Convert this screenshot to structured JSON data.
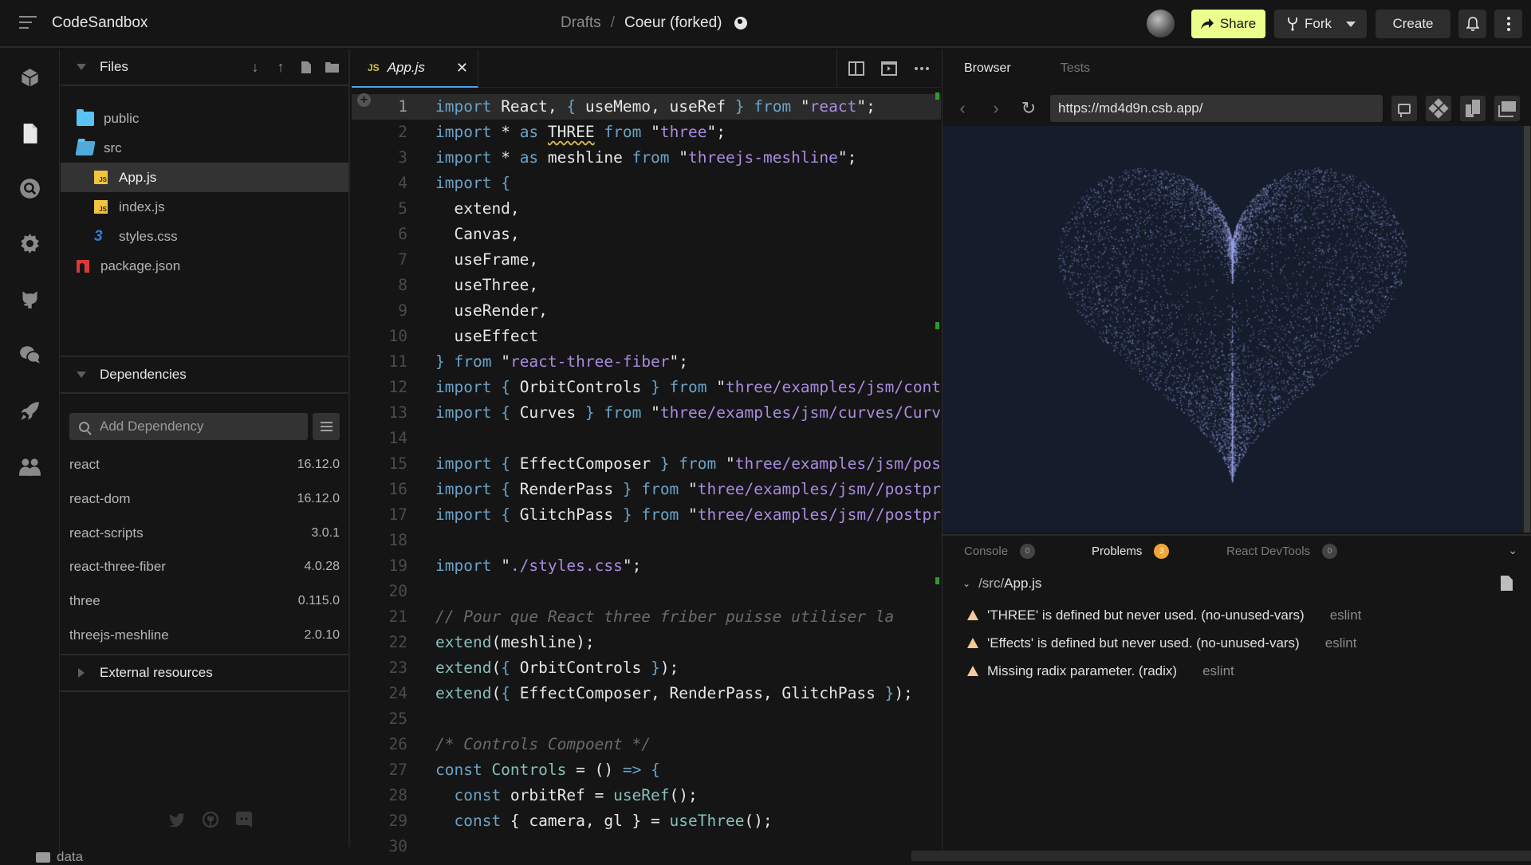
{
  "topbar": {
    "app_title": "CodeSandbox",
    "breadcrumb": {
      "parent": "Drafts",
      "separator": "/",
      "current": "Coeur (forked)"
    },
    "buttons": {
      "share": "Share",
      "fork": "Fork",
      "create": "Create"
    },
    "icons": [
      "menu-icon",
      "globe-icon",
      "avatar",
      "share-arrow-icon",
      "fork-icon",
      "chevron-down-icon",
      "bell-icon",
      "kebab-icon"
    ]
  },
  "activity_bar": {
    "items": [
      {
        "name": "sandbox-info",
        "icon": "cube-icon"
      },
      {
        "name": "explorer",
        "icon": "file-icon"
      },
      {
        "name": "search",
        "icon": "search-icon"
      },
      {
        "name": "settings",
        "icon": "gear-icon"
      },
      {
        "name": "github",
        "icon": "github-icon"
      },
      {
        "name": "comments",
        "icon": "chat-icon"
      },
      {
        "name": "deployment",
        "icon": "rocket-icon"
      },
      {
        "name": "live",
        "icon": "users-icon"
      }
    ]
  },
  "files_panel": {
    "title": "Files",
    "tree": [
      {
        "name": "public",
        "type": "folder",
        "level": 0
      },
      {
        "name": "src",
        "type": "folder-open",
        "level": 0
      },
      {
        "name": "App.js",
        "type": "js",
        "level": 1,
        "active": true
      },
      {
        "name": "index.js",
        "type": "js",
        "level": 1
      },
      {
        "name": "styles.css",
        "type": "css",
        "level": 1
      },
      {
        "name": "package.json",
        "type": "npm",
        "level": 0
      }
    ]
  },
  "dependencies": {
    "title": "Dependencies",
    "search_placeholder": "Add Dependency",
    "items": [
      {
        "name": "react",
        "version": "16.12.0"
      },
      {
        "name": "react-dom",
        "version": "16.12.0"
      },
      {
        "name": "react-scripts",
        "version": "3.0.1"
      },
      {
        "name": "react-three-fiber",
        "version": "4.0.28"
      },
      {
        "name": "three",
        "version": "0.115.0"
      },
      {
        "name": "threejs-meshline",
        "version": "2.0.10"
      }
    ]
  },
  "external_resources": {
    "title": "External resources"
  },
  "footer": {
    "folder_label": "data"
  },
  "editor": {
    "tab": {
      "badge": "JS",
      "label": "App.js"
    },
    "current_line": 1,
    "lines": [
      [
        [
          "k",
          "import"
        ],
        [
          "w",
          " React, "
        ],
        [
          "p",
          "{"
        ],
        [
          "w",
          " useMemo, useRef "
        ],
        [
          "p",
          "}"
        ],
        [
          "k",
          " from "
        ],
        [
          "w",
          "\""
        ],
        [
          "s",
          "react"
        ],
        [
          "w",
          "\";"
        ]
      ],
      [
        [
          "k",
          "import"
        ],
        [
          "w",
          " * "
        ],
        [
          "k",
          "as"
        ],
        [
          "w",
          " "
        ],
        [
          "sq",
          "THREE"
        ],
        [
          "k",
          " from "
        ],
        [
          "w",
          "\""
        ],
        [
          "s",
          "three"
        ],
        [
          "w",
          "\";"
        ]
      ],
      [
        [
          "k",
          "import"
        ],
        [
          "w",
          " * "
        ],
        [
          "k",
          "as"
        ],
        [
          "w",
          " meshline "
        ],
        [
          "k",
          "from "
        ],
        [
          "w",
          "\""
        ],
        [
          "s",
          "threejs-meshline"
        ],
        [
          "w",
          "\";"
        ]
      ],
      [
        [
          "k",
          "import"
        ],
        [
          "w",
          " "
        ],
        [
          "p",
          "{"
        ]
      ],
      [
        [
          "w",
          "  extend,"
        ]
      ],
      [
        [
          "w",
          "  Canvas,"
        ]
      ],
      [
        [
          "w",
          "  useFrame,"
        ]
      ],
      [
        [
          "w",
          "  useThree,"
        ]
      ],
      [
        [
          "w",
          "  useRender,"
        ]
      ],
      [
        [
          "w",
          "  useEffect"
        ]
      ],
      [
        [
          "p",
          "}"
        ],
        [
          "k",
          " from "
        ],
        [
          "w",
          "\""
        ],
        [
          "s",
          "react-three-fiber"
        ],
        [
          "w",
          "\";"
        ]
      ],
      [
        [
          "k",
          "import"
        ],
        [
          "w",
          " "
        ],
        [
          "p",
          "{"
        ],
        [
          "w",
          " OrbitControls "
        ],
        [
          "p",
          "}"
        ],
        [
          "k",
          " from "
        ],
        [
          "w",
          "\""
        ],
        [
          "s",
          "three/examples/jsm/controls/OrbitControls"
        ],
        [
          "w",
          "\";"
        ]
      ],
      [
        [
          "k",
          "import"
        ],
        [
          "w",
          " "
        ],
        [
          "p",
          "{"
        ],
        [
          "w",
          " Curves "
        ],
        [
          "p",
          "}"
        ],
        [
          "k",
          " from "
        ],
        [
          "w",
          "\""
        ],
        [
          "s",
          "three/examples/jsm/curves/CurveExtras"
        ],
        [
          "w",
          "\";"
        ]
      ],
      [],
      [
        [
          "k",
          "import"
        ],
        [
          "w",
          " "
        ],
        [
          "p",
          "{"
        ],
        [
          "w",
          " EffectComposer "
        ],
        [
          "p",
          "}"
        ],
        [
          "k",
          " from "
        ],
        [
          "w",
          "\""
        ],
        [
          "s",
          "three/examples/jsm/postprocessing/EffectComposer"
        ],
        [
          "w",
          "\";"
        ]
      ],
      [
        [
          "k",
          "import"
        ],
        [
          "w",
          " "
        ],
        [
          "p",
          "{"
        ],
        [
          "w",
          " RenderPass "
        ],
        [
          "p",
          "}"
        ],
        [
          "k",
          " from "
        ],
        [
          "w",
          "\""
        ],
        [
          "s",
          "three/examples/jsm//postprocessing/RenderPass"
        ],
        [
          "w",
          "\";"
        ]
      ],
      [
        [
          "k",
          "import"
        ],
        [
          "w",
          " "
        ],
        [
          "p",
          "{"
        ],
        [
          "w",
          " GlitchPass "
        ],
        [
          "p",
          "}"
        ],
        [
          "k",
          " from "
        ],
        [
          "w",
          "\""
        ],
        [
          "s",
          "three/examples/jsm//postprocessing/GlitchPass"
        ],
        [
          "w",
          "\";"
        ]
      ],
      [],
      [
        [
          "k",
          "import"
        ],
        [
          "w",
          " \""
        ],
        [
          "s",
          "./styles.css"
        ],
        [
          "w",
          "\";"
        ]
      ],
      [],
      [
        [
          "c",
          "// Pour que React three friber puisse utiliser la"
        ]
      ],
      [
        [
          "f",
          "extend"
        ],
        [
          "w",
          "(meshline);"
        ]
      ],
      [
        [
          "f",
          "extend"
        ],
        [
          "w",
          "("
        ],
        [
          "p",
          "{"
        ],
        [
          "w",
          " OrbitControls "
        ],
        [
          "p",
          "}"
        ],
        [
          "w",
          ");"
        ]
      ],
      [
        [
          "f",
          "extend"
        ],
        [
          "w",
          "("
        ],
        [
          "p",
          "{"
        ],
        [
          "w",
          " EffectComposer, RenderPass, GlitchPass "
        ],
        [
          "p",
          "}"
        ],
        [
          "w",
          ");"
        ]
      ],
      [],
      [
        [
          "c",
          "/* Controls Compoent */"
        ]
      ],
      [
        [
          "k",
          "const"
        ],
        [
          "f",
          " Controls"
        ],
        [
          "w",
          " = () "
        ],
        [
          "k",
          "=>"
        ],
        [
          "w",
          " "
        ],
        [
          "p",
          "{"
        ]
      ],
      [
        [
          "w",
          "  "
        ],
        [
          "k",
          "const"
        ],
        [
          "w",
          " orbitRef = "
        ],
        [
          "f",
          "useRef"
        ],
        [
          "w",
          "();"
        ]
      ],
      [
        [
          "w",
          "  "
        ],
        [
          "k",
          "const"
        ],
        [
          "w",
          " { camera, gl } = "
        ],
        [
          "f",
          "useThree"
        ],
        [
          "w",
          "();"
        ]
      ],
      []
    ]
  },
  "preview": {
    "tabs": [
      {
        "label": "Browser",
        "active": true
      },
      {
        "label": "Tests",
        "active": false
      }
    ],
    "url": "https://md4d9n.csb.app/",
    "canvas_bg": "#151c2c",
    "particle_color": "#9aa3e6"
  },
  "devtools": {
    "tabs": [
      {
        "label": "Console",
        "count": "0",
        "active": false
      },
      {
        "label": "Problems",
        "count": "3",
        "active": true
      },
      {
        "label": "React DevTools",
        "count": "0",
        "active": false
      }
    ],
    "file": {
      "dir": "/src/",
      "name": "App.js"
    },
    "problems": [
      {
        "message": "'THREE' is defined but never used. (no-unused-vars)",
        "source": "eslint"
      },
      {
        "message": "'Effects' is defined but never used. (no-unused-vars)",
        "source": "eslint"
      },
      {
        "message": "Missing radix parameter. (radix)",
        "source": "eslint"
      }
    ]
  },
  "colors": {
    "share_accent": "#ecff8c",
    "active_tab_underline": "#4aa3f0",
    "warning_badge": "#f3a532",
    "keyword": "#6aa3c9",
    "string": "#a88be0",
    "function": "#83c0b8"
  }
}
